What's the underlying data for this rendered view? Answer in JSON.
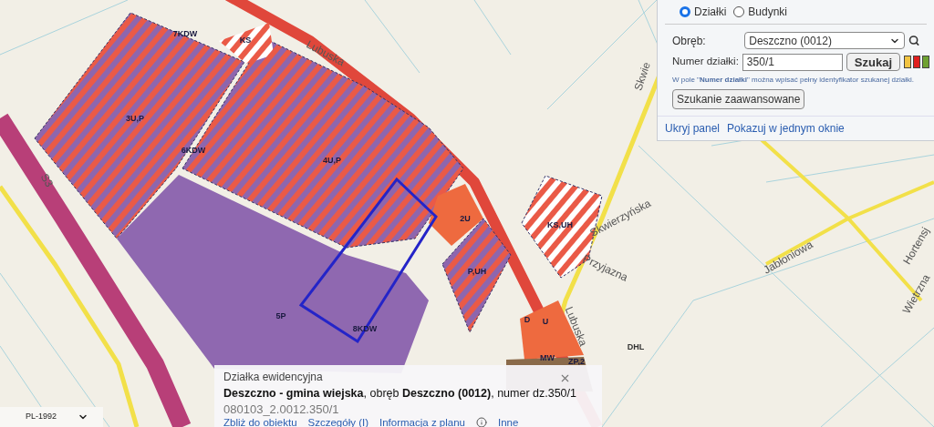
{
  "search_panel": {
    "modes": [
      {
        "label": "Działki",
        "selected": true
      },
      {
        "label": "Budynki",
        "selected": false
      }
    ],
    "precinct": {
      "label": "Obręb:",
      "value": "Deszczno (0012)"
    },
    "parcel_number": {
      "label": "Numer działki:",
      "value": "350/1"
    },
    "search_button": "Szukaj",
    "swatches": [
      {
        "color": "#f2c443"
      },
      {
        "color": "#e01f1f"
      },
      {
        "color": "#6fa232"
      }
    ],
    "hint": "W pole \"**Numer działki**\" można wpisać pełny identyfikator szukanej działki.",
    "advanced_button": "Szukanie zaawansowane",
    "links": [
      "Ukryj panel",
      "Pokazuj w jednym oknie"
    ]
  },
  "map": {
    "zone_labels": [
      "7KDW",
      "KS",
      "3U,P",
      "6KDW",
      "4U,P",
      "2U",
      "KS,UH",
      "P,UH",
      "5P",
      "8KDW",
      "D",
      "U",
      "MW",
      "ZP,2",
      "DHL"
    ],
    "street_labels": [
      "Lubuska",
      "Skwierzyńska",
      "Skwie",
      "Przyjazna",
      "Jabłoniowa",
      "Hortensj",
      "Wietrzna",
      "Lubuska",
      "S3"
    ]
  },
  "popup": {
    "title": "Działka ewidencyjna",
    "description": "**Deszczno - gmina wiejska**, obręb **Deszczno (0012)**, numer dz.350/1",
    "identifier": "080103_2.0012.350/1",
    "links": [
      "Zbliż do obiektu",
      "Szczegóły (I)",
      "Informacja z planu",
      "Inne"
    ]
  },
  "crs_select": {
    "value": "PL-1992"
  }
}
